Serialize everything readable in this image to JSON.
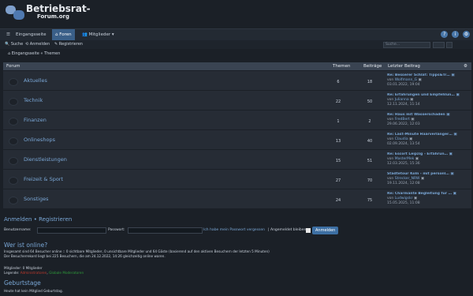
{
  "brand": {
    "line1": "Betriebsrat-",
    "line2": "Forum.org"
  },
  "navbar": {
    "home": "Eingangsseite",
    "forums": "Foren",
    "members": "Mitglieder"
  },
  "subnav": {
    "search": "Suche",
    "login": "Anmelden",
    "register": "Registrieren",
    "search_placeholder": "Suche…"
  },
  "breadcrumb": "Eingangsseite « Themen",
  "table": {
    "headers": {
      "forum": "Forum",
      "topics": "Themen",
      "posts": "Beiträge",
      "last": "Letzter Beitrag"
    },
    "rows": [
      {
        "title": "Aktuelles",
        "topics": "6",
        "posts": "18",
        "last_title": "Re: Besserer Schlaf: Tipps&Tr…",
        "by": "von",
        "user": "Wolfmann_G",
        "date": "03.01.2022, 19:04"
      },
      {
        "title": "Technik",
        "topics": "22",
        "posts": "50",
        "last_title": "Re: Erfahrungen und Empfehlun…",
        "by": "von",
        "user": "Julianna",
        "date": "12.11.2024, 11:14"
      },
      {
        "title": "Finanzen",
        "topics": "1",
        "posts": "2",
        "last_title": "Re: Haus mit Wasserschaden",
        "by": "von",
        "user": "FredBert",
        "date": "29.06.2022, 12:03"
      },
      {
        "title": "Onlineshops",
        "topics": "13",
        "posts": "40",
        "last_title": "Re: Last-Minute Haarverlänger…",
        "by": "von",
        "user": "Claudia",
        "date": "02.09.2024, 13:54"
      },
      {
        "title": "Dienstleistungen",
        "topics": "15",
        "posts": "51",
        "last_title": "Re: Escort Leipzig - Erfahrun…",
        "by": "von",
        "user": "MasterMek",
        "date": "12.03.2025, 15:36"
      },
      {
        "title": "Freizeit & Sport",
        "topics": "27",
        "posts": "70",
        "last_title": "Städtetour Köln - mit persönl…",
        "by": "von",
        "user": "Strecker_NRW",
        "date": "19.11.2024, 12:08"
      },
      {
        "title": "Sonstiges",
        "topics": "24",
        "posts": "75",
        "last_title": "Re: Charmante Begleitung für …",
        "by": "von",
        "user": "Ludwigskr",
        "date": "15.05.2025, 11:08"
      }
    ]
  },
  "login": {
    "login_link": "Anmelden",
    "sep": "•",
    "register_link": "Registrieren",
    "username_label": "Benutzername:",
    "password_label": "Passwort:",
    "forgot": "Ich habe mein Passwort vergessen",
    "stay": "Angemeldet bleiben",
    "submit": "Anmelden"
  },
  "who": {
    "title": "Wer ist online?",
    "line1": "Insgesamt sind 64 Besucher online :: 0 sichtbare Mitglieder, 0 unsichtbare Mitglieder und 64 Gäste (basierend auf den aktiven Besuchern der letzten 5 Minuten)",
    "line2": "Der Besucherrekord liegt bei 225 Besuchern, die am 24.12.2022, 14:26 gleichzeitig online waren.",
    "members": "Mitglieder: 0 Mitglieder",
    "legend_label": "Legende:",
    "admin": "Administratoren",
    "mod": "Globale Moderatoren"
  },
  "birthdays": {
    "title": "Geburtstage",
    "text": "Heute hat kein Mitglied Geburtstag."
  },
  "colors": {
    "accent": "#3a5f88",
    "link": "#7aa7d6",
    "bg": "#1b2027"
  }
}
